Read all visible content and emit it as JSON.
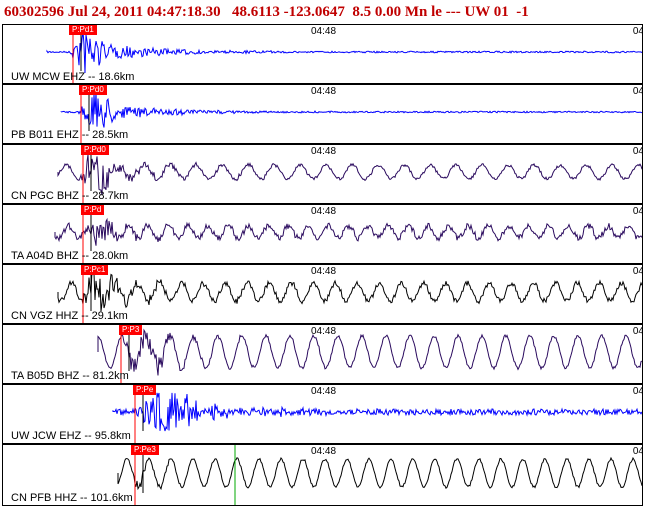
{
  "header": {
    "event_id": "60302596",
    "datetime": "Jul 24, 2011 04:47:18.30",
    "lat": "48.6113",
    "lon": "-123.0647",
    "depth": "8.5",
    "mag": "0.00",
    "mag_type": "Mn",
    "flag": "le ---",
    "network": "UW 01",
    "extra": "-1"
  },
  "time_tick": "04:48",
  "time_tick_right": "04",
  "traces": [
    {
      "label": "UW MCW EHZ -- 18.6km",
      "pick": "P:Pd1",
      "color": "#0000ff"
    },
    {
      "label": "PB B011 EHZ -- 28.5km",
      "pick": "P:Pd0",
      "color": "#0000ff"
    },
    {
      "label": "CN PGC BHZ -- 28.7km",
      "pick": "P:Pd0",
      "color": "#2a0a5e"
    },
    {
      "label": "TA A04D BHZ -- 28.0km",
      "pick": "P:Pd",
      "color": "#2a0a5e"
    },
    {
      "label": "CN VGZ HHZ -- 29.1km",
      "pick": "P:Pc1",
      "color": "#000000"
    },
    {
      "label": "TA B05D BHZ -- 81.2km",
      "pick": "P:P3",
      "color": "#2a0a5e"
    },
    {
      "label": "UW JCW EHZ -- 95.8km",
      "pick": "P:Pe",
      "color": "#0000ff"
    },
    {
      "label": "CN PFB HHZ -- 101.6km",
      "pick": "P:Pe3",
      "color": "#000000"
    }
  ]
}
